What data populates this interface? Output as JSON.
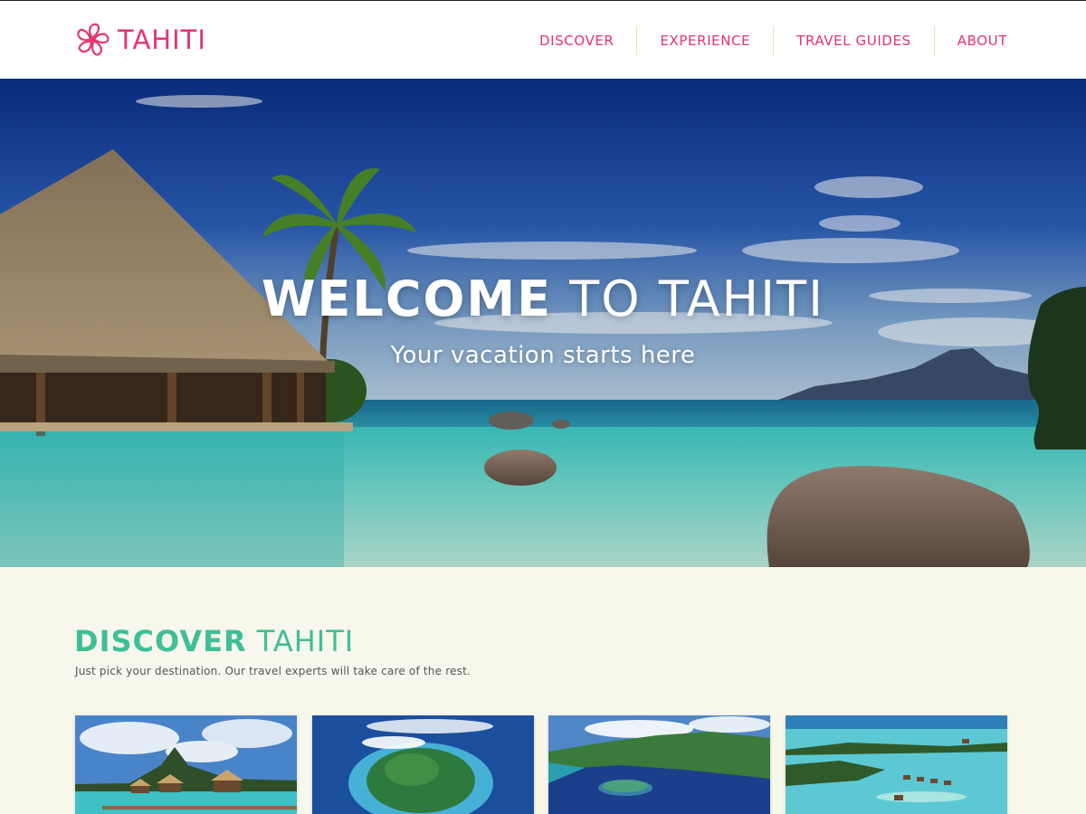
{
  "brand": {
    "name": "TAHITI",
    "accent_color": "#e8336b",
    "logo_icon": "flower-icon"
  },
  "nav": {
    "items": [
      {
        "label": "DISCOVER"
      },
      {
        "label": "EXPERIENCE"
      },
      {
        "label": "TRAVEL GUIDES"
      },
      {
        "label": "ABOUT"
      }
    ]
  },
  "hero": {
    "title_strong": "WELCOME",
    "title_light": "TO TAHITI",
    "subtitle": "Your vacation starts here"
  },
  "discover": {
    "title_strong": "DISCOVER",
    "title_light": "TAHITI",
    "description": "Just pick your destination. Our travel experts will take care of the rest.",
    "accent_color": "#3fbf98",
    "cards": [
      {
        "image": "overwater-bungalows-photo"
      },
      {
        "image": "island-aerial-photo"
      },
      {
        "image": "bay-mountains-photo"
      },
      {
        "image": "atoll-resort-photo"
      }
    ]
  }
}
